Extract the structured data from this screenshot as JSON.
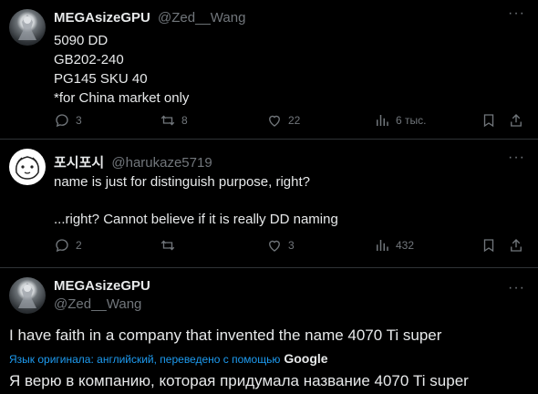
{
  "tweet1": {
    "display_name": "MEGAsizeGPU",
    "handle": "@Zed__Wang",
    "lines": [
      "5090 DD",
      "GB202-240",
      "PG145 SKU 40",
      "*for China market only"
    ],
    "replies": "3",
    "retweets": "8",
    "likes": "22",
    "views": "6 тыс."
  },
  "tweet2": {
    "display_name": "포시포시",
    "handle": "@harukaze5719",
    "line1": "name is just for distinguish purpose, right?",
    "line2": "...right? Cannot believe if it is really DD naming",
    "replies": "2",
    "retweets": "",
    "likes": "3",
    "views": "432"
  },
  "tweet3": {
    "display_name": "MEGAsizeGPU",
    "handle": "@Zed__Wang",
    "text": "I have faith in a company that invented the name 4070 Ti super",
    "translation_note": "Язык оригинала: английский, переведено с помощью",
    "google": "Google",
    "translated": "Я верю в компанию, которая придумала название 4070 Ti super"
  },
  "more_glyph": "···",
  "colors": {
    "background": "#000000",
    "text": "#e7e9ea",
    "muted": "#71767b",
    "link": "#1d9bf0",
    "border": "#2f3336"
  }
}
